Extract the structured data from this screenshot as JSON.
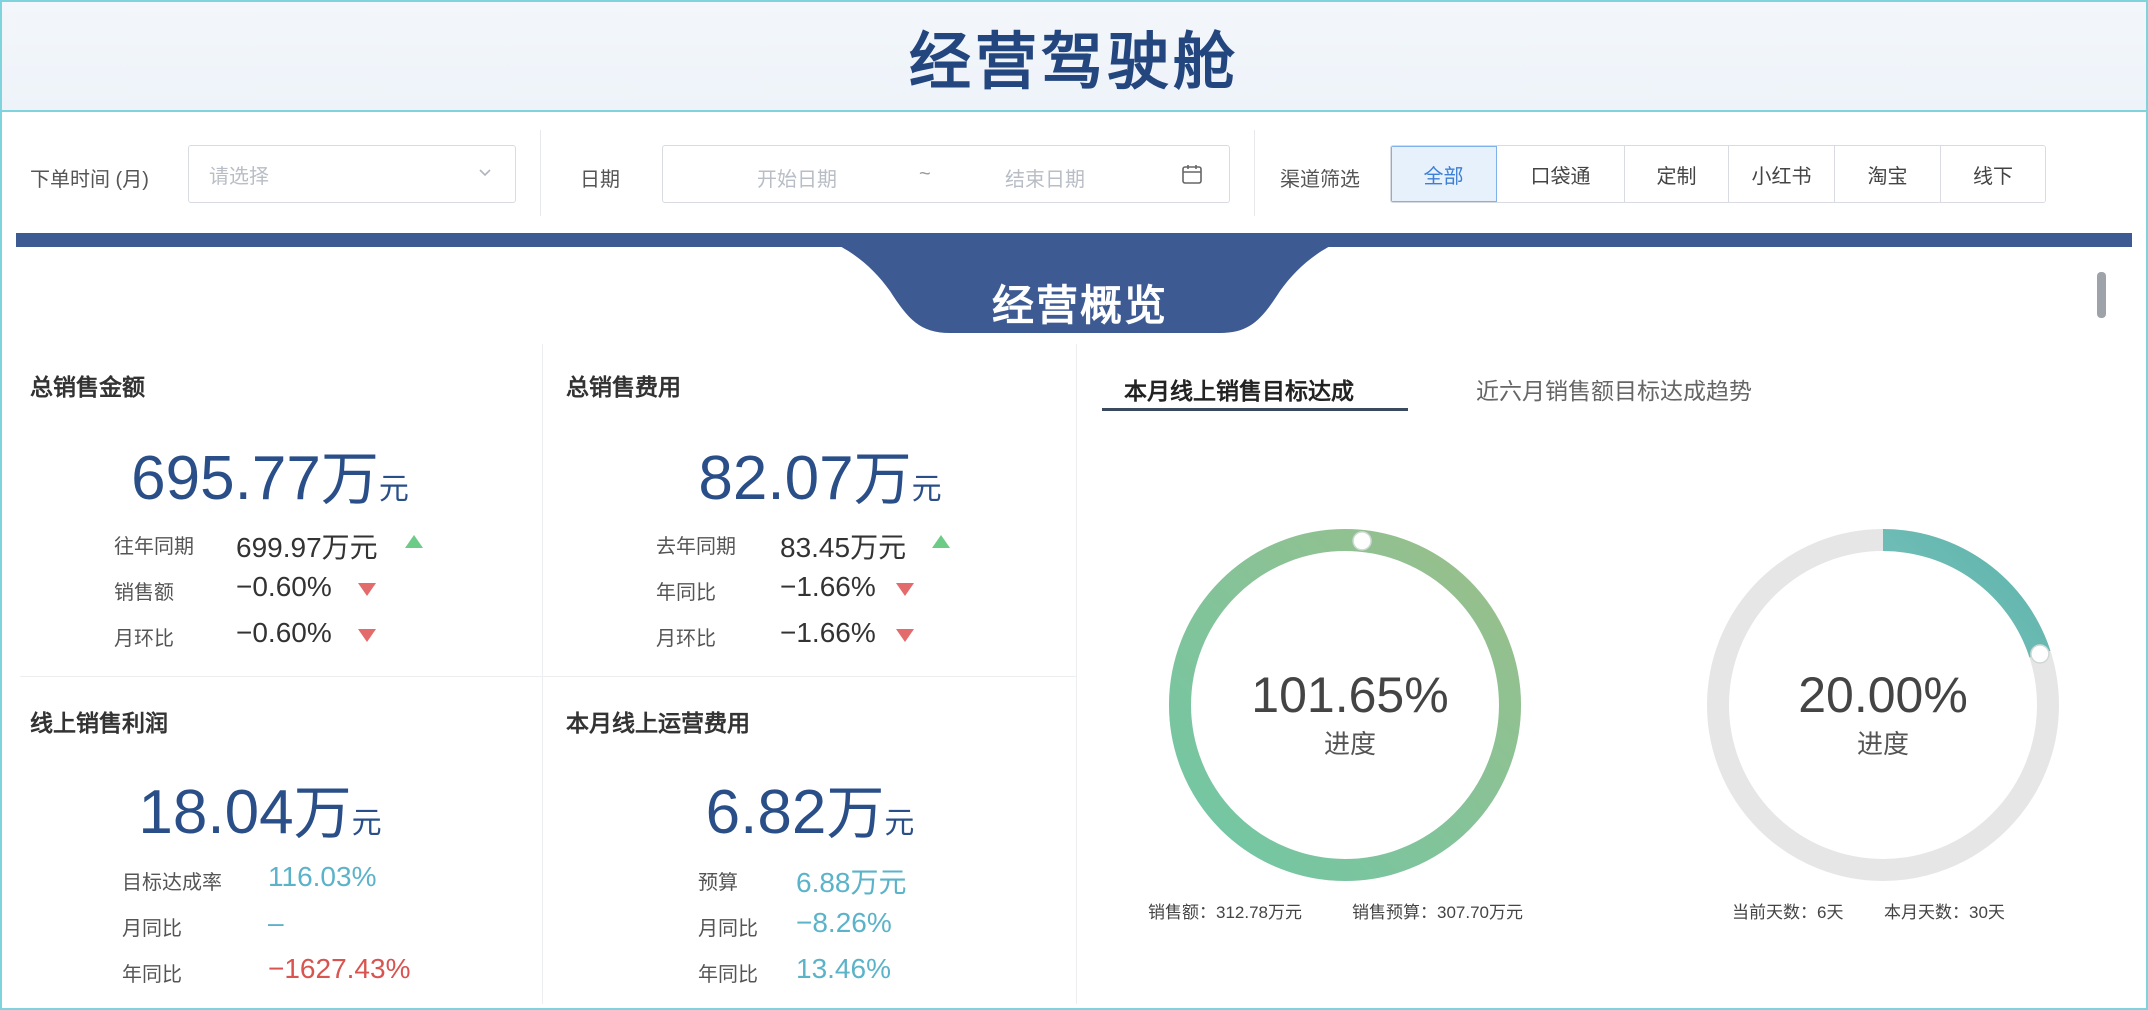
{
  "header": {
    "title": "经营驾驶舱"
  },
  "filters": {
    "order_time_label": "下单时间 (月)",
    "order_time_placeholder": "请选择",
    "date_label": "日期",
    "date_start_placeholder": "开始日期",
    "date_sep": "~",
    "date_end_placeholder": "结束日期",
    "channel_label": "渠道筛选",
    "channels": [
      "全部",
      "口袋通",
      "定制",
      "小红书",
      "淘宝",
      "线下"
    ],
    "active_channel": "全部"
  },
  "overview": {
    "title": "经营概览"
  },
  "cards": {
    "total_sales": {
      "title": "总销售金额",
      "value": "695.77",
      "unit_w": "万",
      "unit_y": "元",
      "rows": [
        {
          "label": "往年同期",
          "value": "699.97万元",
          "trend": "up"
        },
        {
          "label": "销售额",
          "value": "−0.60%",
          "trend": "down"
        },
        {
          "label": "月环比",
          "value": "−0.60%",
          "trend": "down"
        }
      ]
    },
    "total_cost": {
      "title": "总销售费用",
      "value": "82.07",
      "unit_w": "万",
      "unit_y": "元",
      "rows": [
        {
          "label": "去年同期",
          "value": "83.45万元",
          "trend": "up"
        },
        {
          "label": "年同比",
          "value": "−1.66%",
          "trend": "down"
        },
        {
          "label": "月环比",
          "value": "−1.66%",
          "trend": "down"
        }
      ]
    },
    "online_profit": {
      "title": "线上销售利润",
      "value": "18.04",
      "unit_w": "万",
      "unit_y": "元",
      "rows": [
        {
          "label": "目标达成率",
          "value": "116.03%",
          "color": "teal"
        },
        {
          "label": "月同比",
          "value": "–",
          "color": "teal"
        },
        {
          "label": "年同比",
          "value": "−1627.43%",
          "color": "red"
        }
      ]
    },
    "online_opex": {
      "title": "本月线上运营费用",
      "value": "6.82",
      "unit_w": "万",
      "unit_y": "元",
      "rows": [
        {
          "label": "预算",
          "value": "6.88万元",
          "color": "teal"
        },
        {
          "label": "月同比",
          "value": "−8.26%",
          "color": "teal"
        },
        {
          "label": "年同比",
          "value": "13.46%",
          "color": "teal"
        }
      ]
    }
  },
  "tabs": [
    "本月线上销售目标达成",
    "近六月销售额目标达成趋势"
  ],
  "gauges": [
    {
      "percent_text": "101.65%",
      "progress": 1.0165,
      "sub_label": "进度",
      "foot_left": "销售额：312.78万元",
      "foot_right": "销售预算：307.70万元",
      "colors": [
        "#6fc7a6",
        "#9bbf8a"
      ]
    },
    {
      "percent_text": "20.00%",
      "progress": 0.2,
      "sub_label": "进度",
      "foot_left": "当前天数：6天",
      "foot_right": "本月天数：30天",
      "colors": [
        "#a6d8de",
        "#5bb3a8"
      ]
    }
  ],
  "colors": {
    "title": "#23467e",
    "banner": "#3d5a93",
    "kpi_value": "#2a4f88",
    "up": "#6ccb87",
    "down": "#e36b6b",
    "teal": "#5bb3c9",
    "red": "#d9534f"
  }
}
